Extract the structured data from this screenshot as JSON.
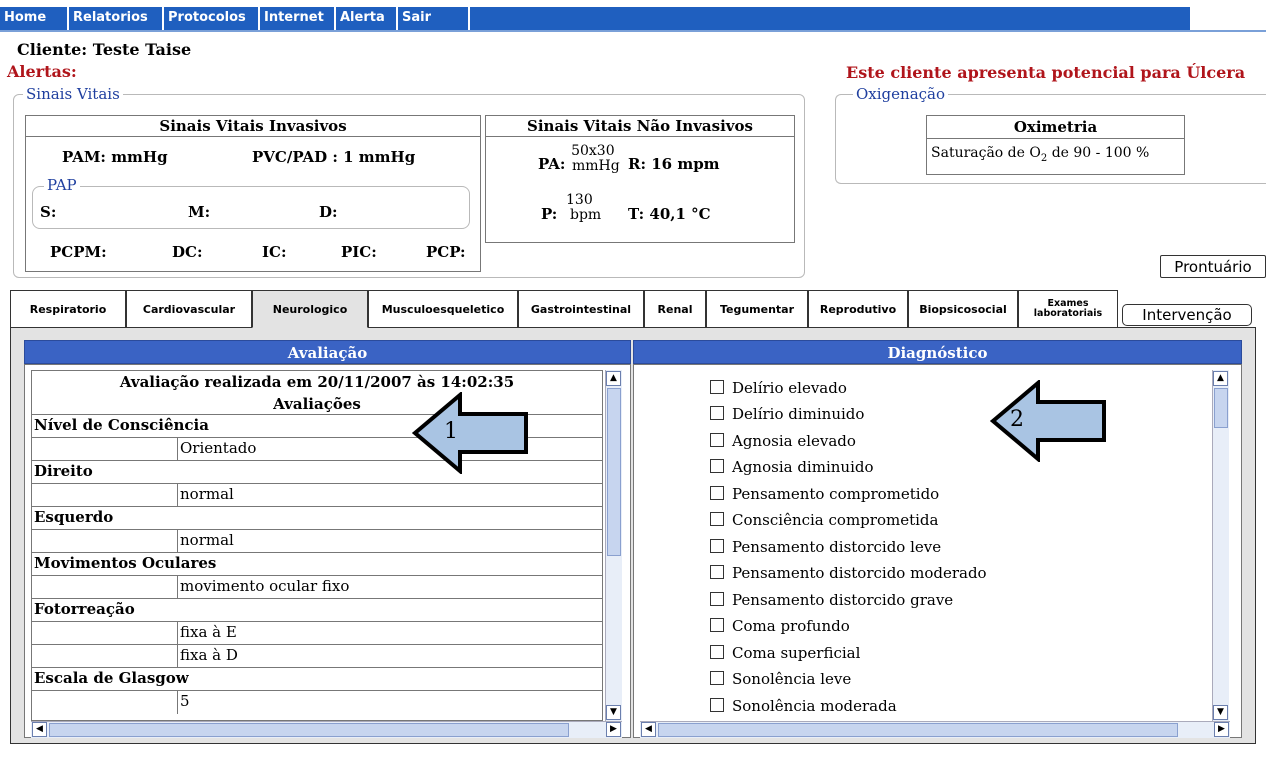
{
  "menu": [
    "Home",
    "Relatorios",
    "Protocolos",
    "Internet",
    "Alerta",
    "Sair"
  ],
  "client": "Cliente: Teste Taise",
  "alerts_label": "Alertas:",
  "alert_message": "Este cliente apresenta potencial para Úlcera",
  "vitals": {
    "legend": "Sinais Vitais",
    "invasive": {
      "title": "Sinais Vitais Invasivos",
      "pam": "PAM:  mmHg",
      "pvc": "PVC/PAD : 1 mmHg",
      "pap_legend": "PAP",
      "s": "S:",
      "m": "M:",
      "d": "D:",
      "pcpm": "PCPM:",
      "dc": "DC:",
      "ic": "IC:",
      "pic": "PIC:",
      "pcp": "PCP:"
    },
    "noninvasive": {
      "title": "Sinais Vitais Não Invasivos",
      "pa_label": "PA:",
      "pa_value": "50x30",
      "pa_unit": "mmHg",
      "r": "R: 16 mpm",
      "p_label": "P:",
      "p_value": "130",
      "p_unit": "bpm",
      "t": "T: 40,1 °C"
    }
  },
  "oxygen": {
    "legend": "Oxigenação",
    "title": "Oximetria",
    "value_prefix": "Saturação de O",
    "value_sub": "2",
    "value_suffix": " de 90 - 100 %"
  },
  "prontuario": "Prontuário",
  "tabs": [
    "Respiratorio",
    "Cardiovascular",
    "Neurologico",
    "Musculoesqueletico",
    "Gastrointestinal",
    "Renal",
    "Tegumentar",
    "Reprodutivo",
    "Biopsicosocial"
  ],
  "tab_exames": [
    "Exames",
    "laboratoriais"
  ],
  "active_tab": "Neurologico",
  "intervencao": "Intervenção",
  "avaliacao": {
    "header": "Avaliação",
    "datetime": "Avaliação realizada em 20/11/2007 às 14:02:35",
    "subheader": "Avaliações",
    "rows": [
      {
        "label": "Nível de Consciência"
      },
      {
        "value": "Orientado"
      },
      {
        "label": "Direito"
      },
      {
        "value": "normal"
      },
      {
        "label": "Esquerdo"
      },
      {
        "value": "normal"
      },
      {
        "label": "Movimentos Oculares"
      },
      {
        "value": "movimento ocular fixo"
      },
      {
        "label": "Fotorreação"
      },
      {
        "value": "fixa à E"
      },
      {
        "value": "fixa à D"
      },
      {
        "label": "Escala de Glasgow"
      },
      {
        "value": "5"
      }
    ]
  },
  "diagnostico": {
    "header": "Diagnóstico",
    "items": [
      "Delírio elevado",
      "Delírio diminuido",
      "Agnosia elevado",
      "Agnosia diminuido",
      "Pensamento comprometido",
      "Consciência comprometida",
      "Pensamento distorcido leve",
      "Pensamento distorcido moderado",
      "Pensamento distorcido grave",
      "Coma profundo",
      "Coma superficial",
      "Sonolência leve",
      "Sonolência moderada"
    ]
  },
  "arrows": [
    "1",
    "2"
  ],
  "colors": {
    "menu_blue": "#1f5fbf",
    "panel_header": "#3a63c4",
    "alert_red": "#b0151b",
    "arrow_fill": "#a9c4e3"
  }
}
